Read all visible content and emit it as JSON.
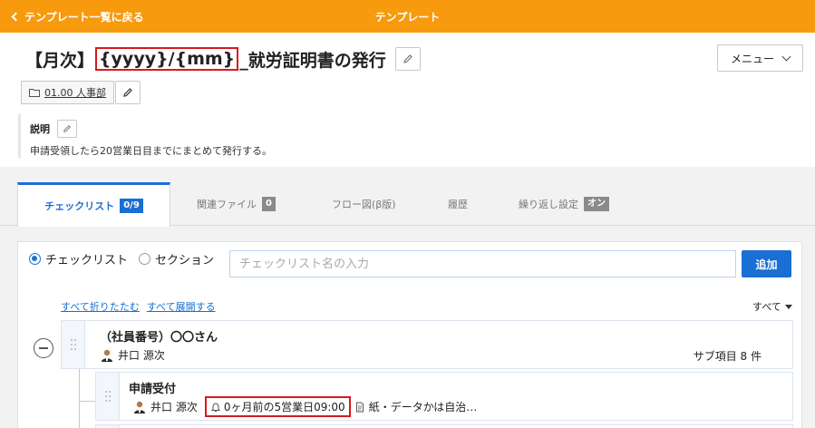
{
  "topbar": {
    "back_label": "テンプレート一覧に戻る",
    "title": "テンプレート",
    "bg_color": "#f79a0e"
  },
  "header": {
    "title_prefix": "【月次】",
    "title_variable": "{yyyy}/{mm}",
    "title_suffix": "_就労証明書の発行",
    "menu_label": "メニュー",
    "folder_label": "01.00 人事部",
    "edit_icon": "pencil-icon",
    "folder_icon": "folder-icon"
  },
  "description": {
    "label": "説明",
    "text": "申請受領したら20営業日目までにまとめて発行する。"
  },
  "tabs": [
    {
      "label": "チェックリスト",
      "badge": "0/9",
      "active": true
    },
    {
      "label": "関連ファイル",
      "badge": "0",
      "active": false
    },
    {
      "label": "フロー図(β版)",
      "badge": "",
      "active": false
    },
    {
      "label": "履歴",
      "badge": "",
      "active": false
    },
    {
      "label": "繰り返し設定",
      "badge": "オン",
      "active": false
    }
  ],
  "checklist": {
    "radio_checklist": "チェックリスト",
    "radio_section": "セクション",
    "input_placeholder": "チェックリスト名の入力",
    "input_value": "",
    "add_label": "追加",
    "collapse_all": "すべて折りたたむ",
    "expand_all": "すべて展開する",
    "filter_label": "すべて",
    "accent_color": "#1a6fd4",
    "highlight_color": "#d7191c"
  },
  "items": [
    {
      "title": "（社員番号）〇〇さん",
      "assignee": "井口 源次",
      "sub_count": "サブ項目 8 件"
    },
    {
      "title": "申請受付",
      "assignee": "井口 源次",
      "deadline": "0ヶ月前の5営業日09:00",
      "note": "紙・データかは自治…"
    }
  ]
}
